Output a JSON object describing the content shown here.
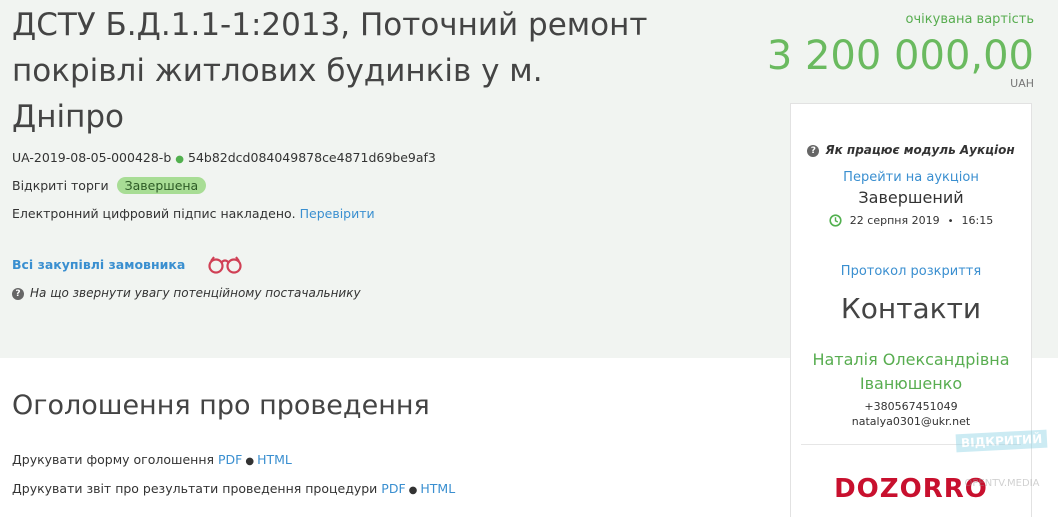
{
  "tender": {
    "title": "ДСТУ Б.Д.1.1-1:2013, Поточний ремонт покрівлі житлових будинків у м. Дніпро",
    "id": "UA-2019-08-05-000428-b",
    "hash": "54b82dcd084049878ce4871d69be9af3",
    "procedure_type": "Відкриті торги",
    "status_badge": "Завершена",
    "signature_text": "Електронний цифровий підпис накладено.",
    "signature_link": "Перевірити",
    "all_purchases_link": "Всі закупівлі замовника",
    "supplier_hint": "На що звернути увагу потенційному постачальнику"
  },
  "expected_value": {
    "label": "очікувана вартість",
    "amount": "3 200 000,00",
    "currency": "UAH"
  },
  "auction_panel": {
    "help_text": "Як працює модуль Аукціон",
    "go_to_auction": "Перейти на аукціон",
    "status": "Завершений",
    "date": "22 серпня 2019",
    "time": "16:15",
    "opening_protocol": "Протокол розкриття",
    "contacts_title": "Контакти",
    "contact_name": "Наталія Олександрівна Іванюшенко",
    "contact_phone": "+380567451049",
    "contact_email": "natalya0301@ukr.net",
    "logo_text": "DOZORRO"
  },
  "announcement": {
    "title": "Оголошення про проведення",
    "print_form_label": "Друкувати форму оголошення",
    "print_report_label": "Друкувати звіт про результати проведення процедури",
    "pdf": "PDF",
    "html": "HTML"
  },
  "watermark": {
    "line1": "ВІДКРИТИЙ",
    "line2": "OPENTV.MEDIA"
  },
  "colors": {
    "accent_green": "#6aba5f",
    "link_blue": "#3a8fd0",
    "badge_green": "#a8dd95",
    "dozorro_red": "#c8102e"
  }
}
